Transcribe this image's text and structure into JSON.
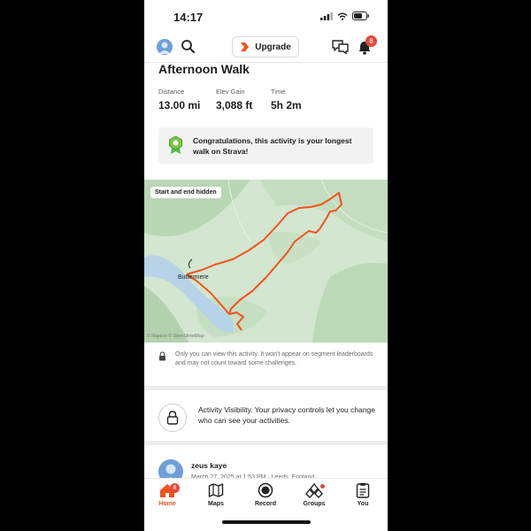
{
  "status_bar": {
    "time": "14:17"
  },
  "header": {
    "upgrade_label": "Upgrade",
    "notification_count": "8",
    "icons": [
      "avatar",
      "search-icon",
      "upgrade-chevron-icon",
      "chat-icon",
      "bell-icon"
    ]
  },
  "activity": {
    "title": "Afternoon Walk",
    "stats": [
      {
        "label": "Distance",
        "value": "13.00 mi"
      },
      {
        "label": "Elev Gain",
        "value": "3,088 ft"
      },
      {
        "label": "Time",
        "value": "5h 2m"
      }
    ],
    "achievement": "Congratulations, this activity is your longest walk on Strava!"
  },
  "map": {
    "badge": "Start and end hidden",
    "place_label": "Buttermere",
    "credit": "© Mapbox © OpenStreetMap",
    "route_color": "#f2531c"
  },
  "privacy": {
    "note": "Only you can view this activity. It won't appear on segment leaderboards and may not count toward some challenges.",
    "visibility_text": "Activity Visibility. Your privacy controls let you change who can see your activities."
  },
  "next_post": {
    "name": "zeus kaye",
    "meta": "March 27, 2025 at 1:53 PM · Leeds, England"
  },
  "bottom_nav": {
    "items": [
      {
        "label": "Home",
        "badge": "8",
        "active": true
      },
      {
        "label": "Maps"
      },
      {
        "label": "Record"
      },
      {
        "label": "Groups"
      },
      {
        "label": "You"
      }
    ]
  },
  "colors": {
    "accent": "#f2531c",
    "badge": "#e34a3c",
    "map_bg": "#cfe3cd",
    "water": "#b8d4ea"
  }
}
